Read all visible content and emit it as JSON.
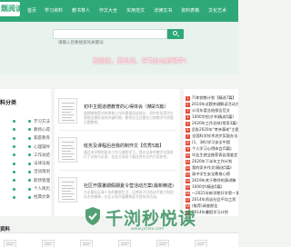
{
  "header": {
    "logo": "题阅读",
    "nav": [
      "首页",
      "学习资料",
      "教书育人",
      "作文大全",
      "实用范文",
      "法律文书",
      "资料表格",
      "文化艺术"
    ]
  },
  "banner": {
    "search_placeholder": "请输入您要搜索的关键词",
    "slogan": "爱阅读，爱生活，学习办公好帮手！"
  },
  "categories": {
    "title": "料分类",
    "rows": [
      [
        "",
        "学习方法"
      ],
      [
        "",
        "教师心得"
      ],
      [
        "",
        "家庭教育"
      ],
      [
        "",
        "心理辅导"
      ],
      [
        "",
        "工作总结"
      ],
      [
        "",
        "法律法规"
      ],
      [
        "",
        "活动策划"
      ],
      [
        "",
        "职场管理"
      ],
      [
        "",
        "个人简历"
      ],
      [
        "",
        "经典文章"
      ]
    ]
  },
  "articles": [
    {
      "title": "初中主题道德教育的心得体会（精彩5篇）",
      "desc": "道德教育是学校德育工作的重要组成部分，初中阶段是学生思想品德形成的关键时期，教师应当注重在日常教学中渗透主题教育。"
    },
    {
      "title": "班务及课程后自我的制作文【优秀5篇】",
      "desc": "通过本学期的班务工作与课程学习，我对自身的教学实践进行了总结与反思，在此分享若干篇优秀作文供大家参考。"
    },
    {
      "title": "社区开展暑期假期夏令营活动方案(最新精选)",
      "desc": "为丰富社区青少年的暑期生活，培养孩子们的动手能力和团队合作精神，社区计划开展暑期夏令营系列活动。"
    }
  ],
  "ranking": [
    "汽车销售计划【精选7篇】",
    "2014年试题关键解读活动方案",
    "公司年度总结报告范文",
    "1000字检讨书(精选5篇)",
    "2020年工作总结(常用3篇)",
    "呈批2020年\"孝亲尊老\"主题活",
    "全国科学技术进步奖励办法",
    "(1、3的)学习安全中国",
    "个人学习心得体会(5篇)",
    "毕业生就业推荐表自我鉴定",
    "2020年下半年工作计划",
    "我的家乡作文(精选5篇)",
    "高中学生安全教育心得",
    "2019年关于教师的演讲稿",
    "1000字(精选5篇)",
    "一2021年新学期开学第一课",
    "2014年再谈社会平均工资",
    "(推荐)调查报告",
    "2014年暑假学习计划"
  ],
  "bottom": {
    "title": "资料"
  },
  "watermark": {
    "text": "千浏秒悦读",
    "url": "www.jxrszx.com"
  },
  "colors": {
    "brand_green": "#2fa877",
    "rank_badge": "#e74c3c",
    "slogan_glow": "#eb6d85"
  }
}
